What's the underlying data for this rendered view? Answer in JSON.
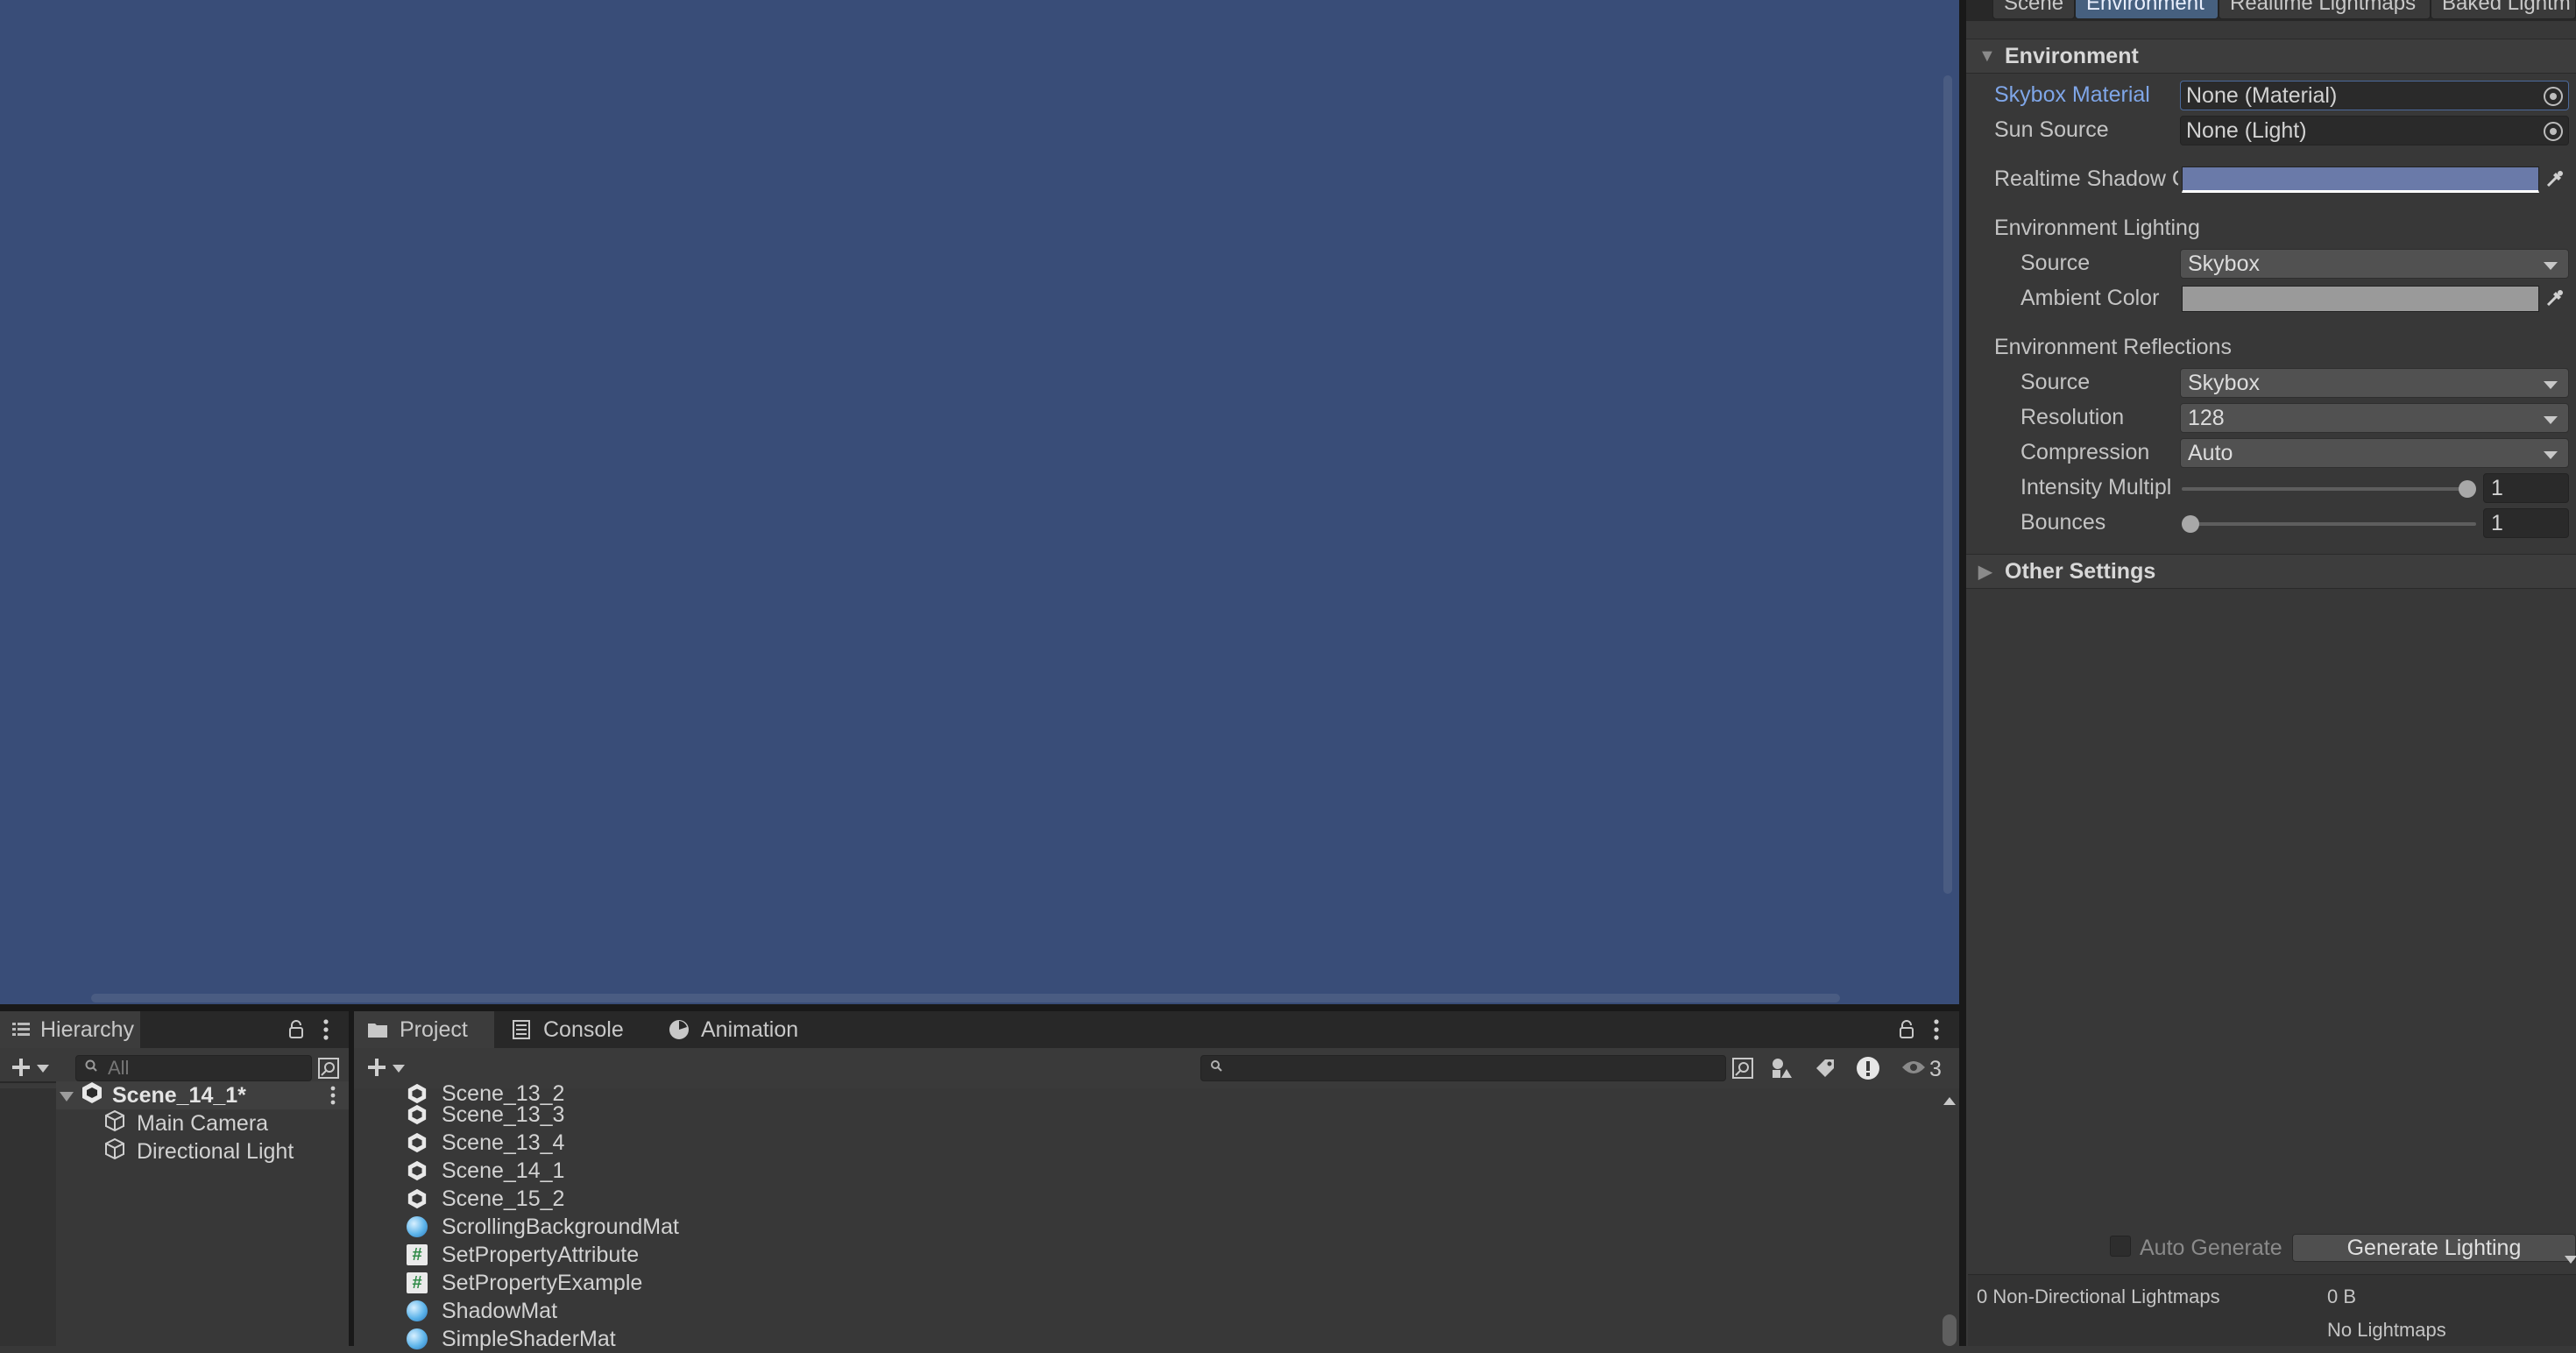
{
  "lighting": {
    "tabs": [
      "Scene",
      "Environment",
      "Realtime Lightmaps",
      "Baked Lightm"
    ],
    "environment_header": "Environment",
    "skybox_material_label": "Skybox Material",
    "skybox_material_value": "None (Material)",
    "sun_source_label": "Sun Source",
    "sun_source_value": "None (Light)",
    "realtime_shadow_label": "Realtime Shadow C",
    "realtime_shadow_color": "#6a7aa9",
    "env_lighting_header": "Environment Lighting",
    "env_lighting_source_label": "Source",
    "env_lighting_source_value": "Skybox",
    "ambient_color_label": "Ambient Color",
    "ambient_color": "#9a9a9a",
    "env_reflections_header": "Environment Reflections",
    "reflections_source_label": "Source",
    "reflections_source_value": "Skybox",
    "resolution_label": "Resolution",
    "resolution_value": "128",
    "compression_label": "Compression",
    "compression_value": "Auto",
    "intensity_label": "Intensity Multipl",
    "intensity_value": "1",
    "intensity_slider_fraction": 1.0,
    "bounces_label": "Bounces",
    "bounces_value": "1",
    "bounces_slider_fraction": 0.0,
    "other_settings_header": "Other Settings",
    "auto_generate_label": "Auto Generate",
    "generate_button": "Generate Lighting",
    "lightmaps_count": "0 Non-Directional Lightmaps",
    "lightmaps_size": "0 B",
    "no_lightmaps": "No Lightmaps"
  },
  "hierarchy": {
    "tab_label": "Hierarchy",
    "search_placeholder": "All",
    "scene_name": "Scene_14_1*",
    "items": [
      "Main Camera",
      "Directional Light"
    ]
  },
  "bottom_tabs": {
    "project": "Project",
    "console": "Console",
    "animation": "Animation"
  },
  "project": {
    "hidden_count": "3",
    "items": [
      {
        "name": "Scene_13_2",
        "type": "scene"
      },
      {
        "name": "Scene_13_3",
        "type": "scene"
      },
      {
        "name": "Scene_13_4",
        "type": "scene"
      },
      {
        "name": "Scene_14_1",
        "type": "scene"
      },
      {
        "name": "Scene_15_2",
        "type": "scene"
      },
      {
        "name": "ScrollingBackgroundMat",
        "type": "material"
      },
      {
        "name": "SetPropertyAttribute",
        "type": "script"
      },
      {
        "name": "SetPropertyExample",
        "type": "script"
      },
      {
        "name": "ShadowMat",
        "type": "material"
      },
      {
        "name": "SimpleShaderMat",
        "type": "material"
      }
    ]
  },
  "colors": {
    "scene_background": "#394d78",
    "accent_label": "#7fa6e8"
  }
}
